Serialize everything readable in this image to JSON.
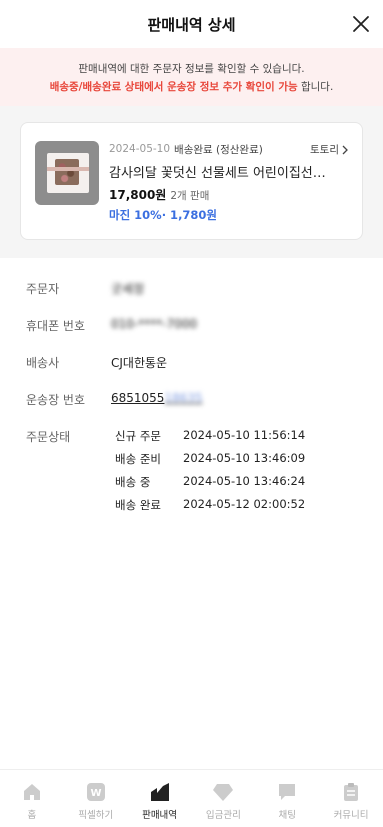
{
  "header": {
    "title": "판매내역 상세"
  },
  "notice": {
    "line1": "판매내역에 대한 주문자 정보를 확인할 수 있습니다.",
    "line2_highlight": "배송중/배송완료 상태에서 운송장 정보 추가 확인이 가능",
    "line2_suffix": " 합니다."
  },
  "order_card": {
    "date": "2024-05-10",
    "status": "배송완료 (정산완료)",
    "store_label": "토토리",
    "product_name": "감사의달 꽃덧신 선물세트 어린이집선물 스승의",
    "price": "17,800원",
    "qty": "2개 판매",
    "margin": "마진 10%· 1,780원"
  },
  "details": {
    "orderer_label": "주문자",
    "orderer_value": "굿세정",
    "phone_label": "휴대폰 번호",
    "phone_value": "010-****-7000",
    "courier_label": "배송사",
    "courier_value": "CJ대한통운",
    "tracking_label": "운송장 번호",
    "tracking_visible": "6851055",
    "tracking_hidden": "18635",
    "order_status_label": "주문상태",
    "statuses": [
      {
        "name": "신규 주문",
        "time": "2024-05-10 11:56:14"
      },
      {
        "name": "배송 준비",
        "time": "2024-05-10 13:46:09"
      },
      {
        "name": "배송 중",
        "time": "2024-05-10 13:46:24"
      },
      {
        "name": "배송 완료",
        "time": "2024-05-12 02:00:52"
      }
    ]
  },
  "tabbar": {
    "items": [
      {
        "label": "홈",
        "icon": "home-icon"
      },
      {
        "label": "픽셀하기",
        "icon": "w-icon"
      },
      {
        "label": "판매내역",
        "icon": "chart-icon",
        "active": true
      },
      {
        "label": "입금관리",
        "icon": "diamond-icon"
      },
      {
        "label": "채팅",
        "icon": "chat-icon"
      },
      {
        "label": "커뮤니티",
        "icon": "clipboard-icon"
      }
    ]
  },
  "colors": {
    "accent_red": "#e8473b",
    "accent_blue": "#3b6fe0",
    "notice_bg": "#fdf0f0"
  }
}
